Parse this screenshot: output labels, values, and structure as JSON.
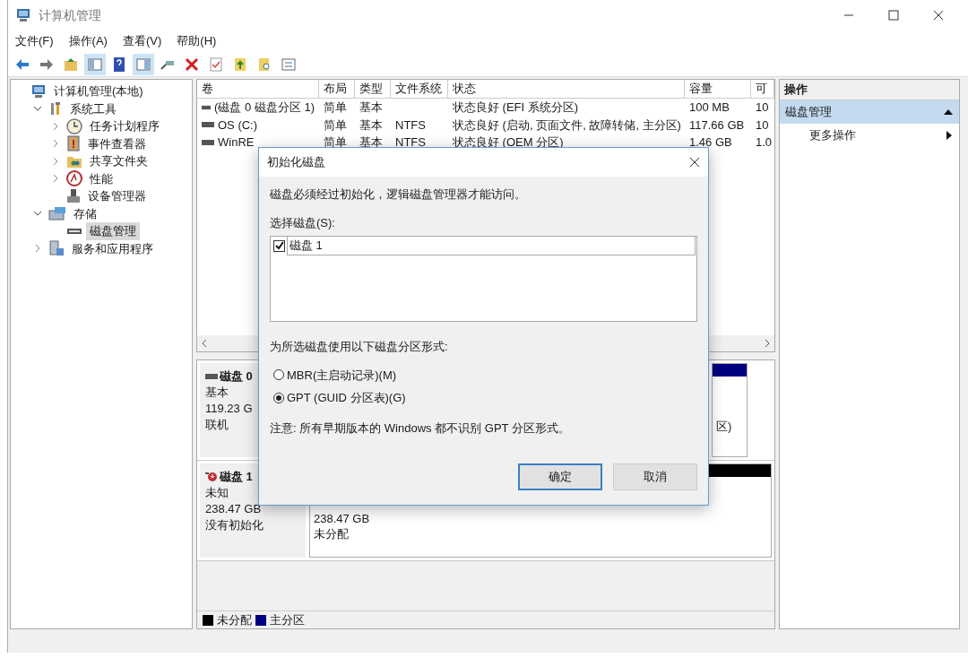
{
  "window": {
    "title": "计算机管理"
  },
  "menu": [
    "文件(F)",
    "操作(A)",
    "查看(V)",
    "帮助(H)"
  ],
  "tree": [
    {
      "label": "计算机管理(本地)",
      "kind": "computer",
      "selected": false,
      "children": [
        {
          "label": "系统工具",
          "kind": "tools",
          "expanded": true,
          "selected": false,
          "children": [
            {
              "label": "任务计划程序",
              "kind": "clock",
              "expanded": false,
              "selected": false
            },
            {
              "label": "事件查看器",
              "kind": "log",
              "expanded": false,
              "selected": false
            },
            {
              "label": "共享文件夹",
              "kind": "folder",
              "expanded": false,
              "selected": false
            },
            {
              "label": "性能",
              "kind": "perf",
              "expanded": false,
              "selected": false
            },
            {
              "label": "设备管理器",
              "kind": "device",
              "selected": false
            }
          ]
        },
        {
          "label": "存储",
          "kind": "storage",
          "expanded": true,
          "selected": false,
          "children": [
            {
              "label": "磁盘管理",
              "kind": "disk",
              "selected": true
            }
          ]
        },
        {
          "label": "服务和应用程序",
          "kind": "services",
          "expanded": false,
          "selected": false
        }
      ]
    }
  ],
  "volumes": {
    "columns": [
      "卷",
      "布局",
      "类型",
      "文件系统",
      "状态",
      "容量",
      "可"
    ],
    "rows": [
      {
        "cells": [
          "(磁盘 0 磁盘分区 1)",
          "简单",
          "基本",
          "",
          "状态良好 (EFI 系统分区)",
          "100 MB",
          "10"
        ]
      },
      {
        "cells": [
          "OS (C:)",
          "简单",
          "基本",
          "NTFS",
          "状态良好 (启动, 页面文件, 故障转储, 主分区)",
          "117.66 GB",
          "10"
        ]
      },
      {
        "cells": [
          "WinRE",
          "简单",
          "基本",
          "NTFS",
          "状态良好 (OEM 分区)",
          "1.46 GB",
          "1.0"
        ]
      }
    ]
  },
  "disks": [
    {
      "name": "磁盘 0",
      "kind": "online",
      "lines": [
        "基本",
        "119.23 G",
        "联机"
      ],
      "partitions": [
        {
          "color": "#000080",
          "lines": [
            "区)"
          ]
        }
      ]
    },
    {
      "name": "磁盘 1",
      "kind": "unknown",
      "lines": [
        "未知",
        "238.47 GB",
        "没有初始化"
      ],
      "partitions": [
        {
          "color": "#000000",
          "lines": [
            "238.47 GB",
            "未分配"
          ]
        }
      ]
    }
  ],
  "legend": [
    {
      "label": "未分配",
      "color": "#000000"
    },
    {
      "label": "主分区",
      "color": "#000080"
    }
  ],
  "actions": {
    "title": "操作",
    "items": [
      {
        "label": "磁盘管理",
        "kind": "section",
        "expanded": true
      },
      {
        "label": "更多操作",
        "kind": "submenu"
      }
    ]
  },
  "dialog": {
    "title": "初始化磁盘",
    "message": "磁盘必须经过初始化，逻辑磁盘管理器才能访问。",
    "select_label": "选择磁盘(S):",
    "disks": [
      {
        "label": "磁盘 1",
        "checked": true
      }
    ],
    "prompt": "为所选磁盘使用以下磁盘分区形式:",
    "options": [
      {
        "label": "MBR(主启动记录)(M)",
        "selected": false
      },
      {
        "label": "GPT (GUID 分区表)(G)",
        "selected": true
      }
    ],
    "note": "注意: 所有早期版本的 Windows 都不识别 GPT 分区形式。",
    "buttons": [
      {
        "label": "确定",
        "kind": "default"
      },
      {
        "label": "取消",
        "kind": "normal"
      }
    ]
  }
}
